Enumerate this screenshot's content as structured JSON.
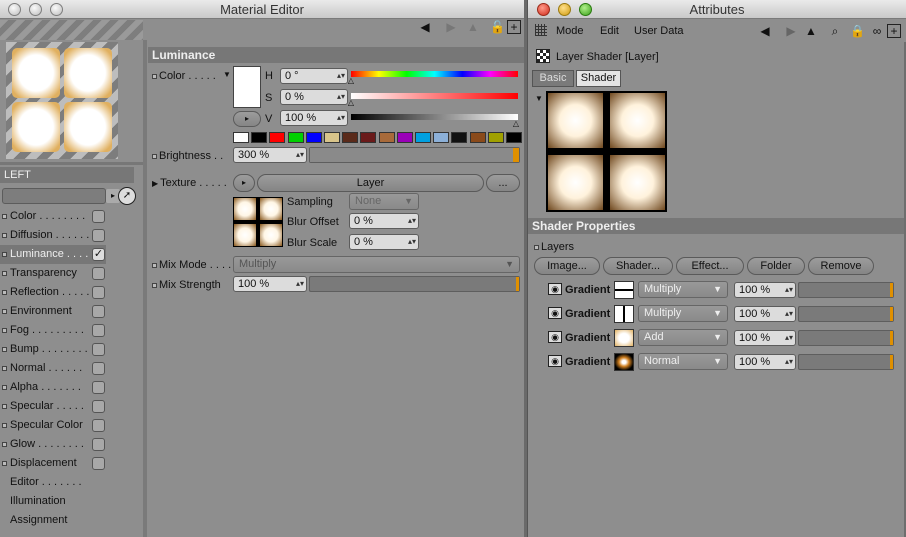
{
  "material_editor": {
    "title": "Material Editor",
    "material_name": "LEFT",
    "channels": [
      {
        "label": "Color . . . . . . . .",
        "checked": false,
        "active": false
      },
      {
        "label": "Diffusion . . . . . .",
        "checked": false,
        "active": false
      },
      {
        "label": "Luminance . . . .",
        "checked": true,
        "active": true
      },
      {
        "label": "Transparency",
        "checked": false,
        "active": false
      },
      {
        "label": "Reflection . . . . .",
        "checked": false,
        "active": false
      },
      {
        "label": "Environment",
        "checked": false,
        "active": false
      },
      {
        "label": "Fog . . . . . . . . .",
        "checked": false,
        "active": false
      },
      {
        "label": "Bump . . . . . . . .",
        "checked": false,
        "active": false
      },
      {
        "label": "Normal . . . . . .",
        "checked": false,
        "active": false
      },
      {
        "label": "Alpha . . . . . . .",
        "checked": false,
        "active": false
      },
      {
        "label": "Specular . . . . .",
        "checked": false,
        "active": false
      },
      {
        "label": "Specular Color",
        "checked": false,
        "active": false
      },
      {
        "label": "Glow . . . . . . . .",
        "checked": false,
        "active": false
      },
      {
        "label": "Displacement",
        "checked": false,
        "active": false
      }
    ],
    "extra_items": [
      "Editor . . . . . . .",
      "Illumination",
      "Assignment"
    ],
    "section_title": "Luminance",
    "color_label": "Color . . . . .",
    "h_label": "H",
    "h_value": "0 °",
    "s_label": "S",
    "s_value": "0 %",
    "v_label": "V",
    "v_value": "100 %",
    "swatches": [
      "#ffffff",
      "#000000",
      "#ff0000",
      "#00d000",
      "#0000ff",
      "#d8c48a",
      "#5a2a1a",
      "#6a1a1a",
      "#a86a3a",
      "#9a00b8",
      "#00a0e0",
      "#8cb0d8",
      "#111111",
      "#8a4a1a",
      "#a0a000",
      "#000000"
    ],
    "brightness_label": "Brightness . .",
    "brightness_value": "300 %",
    "brightness_fraction": 1.0,
    "texture_label": "Texture . . . . .",
    "texture_button": "Layer",
    "texture_more": "...",
    "sampling_label": "Sampling",
    "sampling_value": "None",
    "blur_offset_label": "Blur Offset",
    "blur_offset_value": "0 %",
    "blur_scale_label": "Blur Scale",
    "blur_scale_value": "0 %",
    "mix_mode_label": "Mix Mode . . . .",
    "mix_mode_value": "Multiply",
    "mix_strength_label": "Mix Strength",
    "mix_strength_value": "100 %"
  },
  "attributes": {
    "title": "Attributes",
    "menu": [
      "Mode",
      "Edit",
      "User Data"
    ],
    "object_label": "Layer Shader [Layer]",
    "tabs": [
      "Basic",
      "Shader"
    ],
    "active_tab": "Shader",
    "section_title": "Shader Properties",
    "layers_label": "Layers",
    "buttons": [
      "Image...",
      "Shader...",
      "Effect...",
      "Folder",
      "Remove"
    ],
    "layers": [
      {
        "name": "Gradient",
        "mode": "Multiply",
        "value": "100 %",
        "thumb": "hline"
      },
      {
        "name": "Gradient",
        "mode": "Multiply",
        "value": "100 %",
        "thumb": "vline"
      },
      {
        "name": "Gradient",
        "mode": "Add",
        "value": "100 %",
        "thumb": "soft"
      },
      {
        "name": "Gradient",
        "mode": "Normal",
        "value": "100 %",
        "thumb": "dark"
      }
    ]
  },
  "icons": {
    "back": "arrow-left-icon",
    "forward": "arrow-right-icon",
    "cursor": "cursor-up-icon",
    "search": "search-icon",
    "lock": "lock-icon",
    "link": "chain-icon",
    "new": "new-window-icon",
    "pick": "pick-arrow-icon",
    "eye": "eye-icon"
  }
}
